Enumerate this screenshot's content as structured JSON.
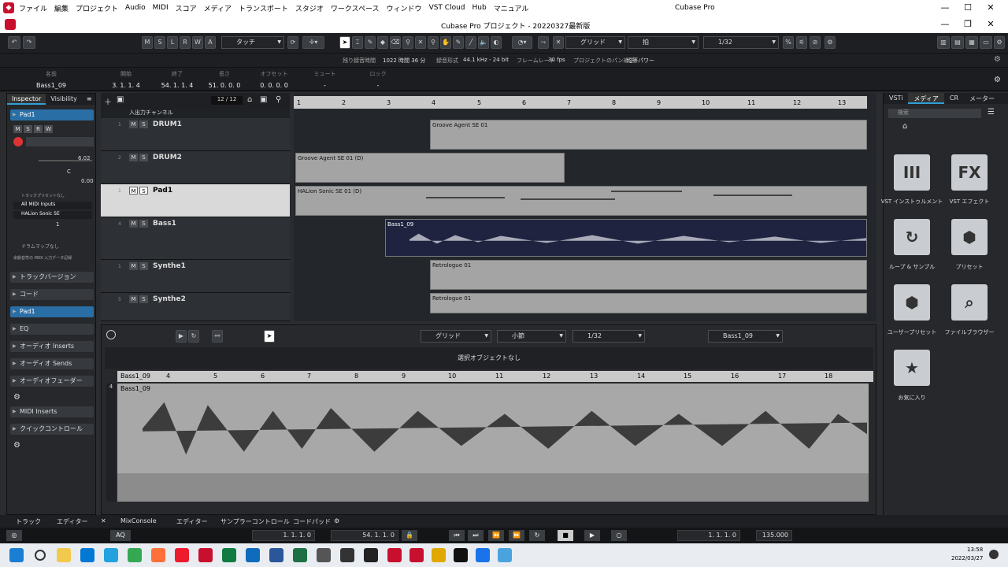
{
  "menubar": {
    "items": [
      "ファイル",
      "編集",
      "プロジェクト",
      "Audio",
      "MIDI",
      "スコア",
      "メディア",
      "トランスポート",
      "スタジオ",
      "ワークスペース",
      "ウィンドウ",
      "VST Cloud",
      "Hub",
      "マニュアル"
    ],
    "app_title": "Cubase Pro"
  },
  "window": {
    "title": "Cubase Pro プロジェクト - 20220327最新版"
  },
  "toolbar": {
    "msrwa": [
      "M",
      "S",
      "L",
      "R",
      "W",
      "A"
    ],
    "automation_mode": "タッチ",
    "snap_label": "グリッド",
    "grid_type": "拍",
    "quantize": "1/32"
  },
  "info": {
    "rec_time_label": "残り録音時間",
    "rec_time": "1022 時間 36 分",
    "rec_format_label": "録音形式",
    "rec_format": "44.1 kHz - 24 bit",
    "framerate_label": "フレームレート",
    "framerate": "30 fps",
    "pan_label": "プロジェクトのパン補正",
    "pan_value": "均等パワー"
  },
  "eventline": {
    "name_label": "名前",
    "name": "Bass1_09",
    "start_label": "開始",
    "start": "3. 1. 1. 4",
    "end_label": "終了",
    "end": "54. 1. 1. 4",
    "length_label": "長さ",
    "length": "51. 0. 0. 0",
    "offset_label": "オフセット",
    "offset": "0. 0. 0. 0",
    "mute_label": "ミュート",
    "mute": "-",
    "lock_label": "ロック",
    "lock": "-"
  },
  "inspector": {
    "tab_inspector": "Inspector",
    "tab_visibility": "Visibility",
    "track_name": "Pad1",
    "volume": "6.02",
    "pan": "C",
    "zero": "0.00",
    "preset": "トラックプリセットなし",
    "input": "All MIDI Inputs",
    "output": "HALion Sonic SE",
    "channel": "1",
    "drummap": "ドラムマップなし",
    "midi_record": "余韻音符の MIDI 入力データ記録",
    "sections": [
      "トラックバージョン",
      "コード",
      "Pad1",
      "EQ",
      "オーディオ Inserts",
      "オーディオ Sends",
      "オーディオフェーダー",
      "MIDI Inserts",
      "クイックコントロール"
    ]
  },
  "tracklist": {
    "count": "12 / 12",
    "io_label": "入出力チャンネル",
    "tracks": [
      {
        "num": "1",
        "name": "DRUM1"
      },
      {
        "num": "2",
        "name": "DRUM2"
      },
      {
        "num": "1",
        "name": "Pad1"
      },
      {
        "num": "4",
        "name": "Bass1"
      },
      {
        "num": "1",
        "name": "Synthe1"
      },
      {
        "num": "5",
        "name": "Synthe2"
      }
    ]
  },
  "arrange": {
    "ruler": [
      "1",
      "2",
      "3",
      "4",
      "5",
      "6",
      "7",
      "8",
      "9",
      "10",
      "11",
      "12",
      "13"
    ],
    "parts": [
      "Groove Agent SE 01",
      "Groove Agent SE 01 (D)",
      "HALion Sonic SE 01 (D)",
      "Bass1_09",
      "Retrologue 01",
      "Retrologue 01"
    ]
  },
  "lower": {
    "snap": "グリッド",
    "grid": "小節",
    "quantize": "1/32",
    "event": "Bass1_09",
    "no_selection": "選択オブジェクトなし",
    "ruler": [
      "Bass1_09",
      "4",
      "5",
      "6",
      "7",
      "8",
      "9",
      "10",
      "11",
      "12",
      "13",
      "14",
      "15",
      "16",
      "17",
      "18"
    ],
    "event_label": "Bass1_09",
    "track_letter": "4"
  },
  "rightpanel": {
    "tabs": [
      "VSTi",
      "メディア",
      "CR",
      "メーター"
    ],
    "search": "検索",
    "tiles": [
      {
        "icon": "piano-icon",
        "glyph": "III",
        "label": "VST インストゥルメント"
      },
      {
        "icon": "fx-icon",
        "glyph": "FX",
        "label": "VST エフェクト"
      },
      {
        "icon": "loop-icon",
        "glyph": "↻",
        "label": "ループ & サンプル"
      },
      {
        "icon": "preset-icon",
        "glyph": "⬢",
        "label": "プリセット"
      },
      {
        "icon": "user-preset-icon",
        "glyph": "⬢",
        "label": "ユーザープリセット"
      },
      {
        "icon": "file-browser-icon",
        "glyph": "⌕",
        "label": "ファイルブラウザー"
      },
      {
        "icon": "star-icon",
        "glyph": "★",
        "label": "お気に入り"
      }
    ]
  },
  "bottomtabs": {
    "left": [
      "トラック",
      "エディター"
    ],
    "right": [
      "MixConsole",
      "エディター",
      "サンプラーコントロール",
      "コードパッド"
    ]
  },
  "transport": {
    "aq": "AQ",
    "left_locator": "1. 1. 1. 0",
    "right_locator": "54. 1. 1. 0",
    "position": "1. 1. 1. 0",
    "tempo": "135.000"
  },
  "taskbar": {
    "time": "13:58",
    "date": "2022/03/27"
  }
}
